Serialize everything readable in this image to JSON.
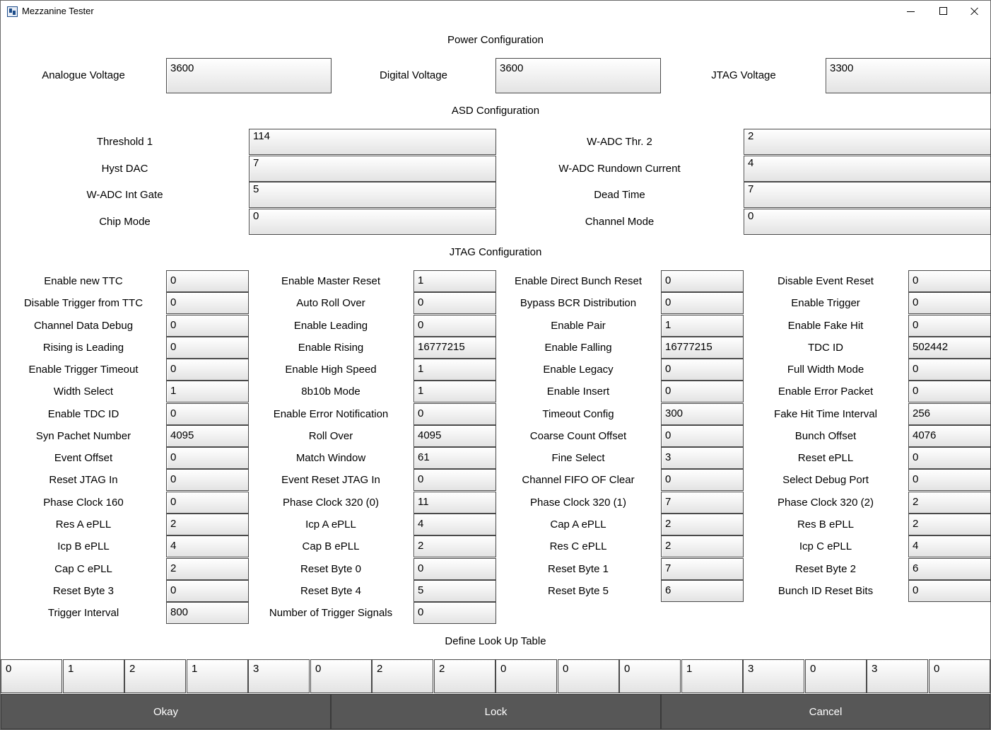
{
  "window": {
    "title": "Mezzanine Tester"
  },
  "power": {
    "title": "Power Configuration",
    "fields": [
      {
        "label": "Analogue Voltage",
        "value": "3600"
      },
      {
        "label": "Digital Voltage",
        "value": "3600"
      },
      {
        "label": "JTAG Voltage",
        "value": "3300"
      }
    ]
  },
  "asd": {
    "title": "ASD Configuration",
    "left": [
      {
        "label": "Threshold 1",
        "value": "114"
      },
      {
        "label": "Hyst DAC",
        "value": "7"
      },
      {
        "label": "W-ADC Int Gate",
        "value": "5"
      },
      {
        "label": "Chip Mode",
        "value": "0"
      }
    ],
    "right": [
      {
        "label": "W-ADC Thr. 2",
        "value": "2"
      },
      {
        "label": "W-ADC Rundown Current",
        "value": "4"
      },
      {
        "label": "Dead Time",
        "value": "7"
      },
      {
        "label": "Channel Mode",
        "value": "0"
      }
    ]
  },
  "jtag": {
    "title": "JTAG Configuration",
    "columns": [
      [
        {
          "label": "Enable new TTC",
          "value": "0"
        },
        {
          "label": "Disable Trigger from TTC",
          "value": "0"
        },
        {
          "label": "Channel Data Debug",
          "value": "0"
        },
        {
          "label": "Rising is Leading",
          "value": "0"
        },
        {
          "label": "Enable Trigger Timeout",
          "value": "0"
        },
        {
          "label": "Width Select",
          "value": "1"
        },
        {
          "label": "Enable TDC ID",
          "value": "0"
        },
        {
          "label": "Syn Pachet Number",
          "value": "4095"
        },
        {
          "label": "Event Offset",
          "value": "0"
        },
        {
          "label": "Reset JTAG In",
          "value": "0"
        },
        {
          "label": "Phase Clock 160",
          "value": "0"
        },
        {
          "label": "Res A ePLL",
          "value": "2"
        },
        {
          "label": "Icp B ePLL",
          "value": "4"
        },
        {
          "label": "Cap C ePLL",
          "value": "2"
        },
        {
          "label": "Reset Byte 3",
          "value": "0"
        },
        {
          "label": "Trigger Interval",
          "value": "800"
        }
      ],
      [
        {
          "label": "Enable Master Reset",
          "value": "1"
        },
        {
          "label": "Auto Roll Over",
          "value": "0"
        },
        {
          "label": "Enable Leading",
          "value": "0"
        },
        {
          "label": "Enable Rising",
          "value": "16777215"
        },
        {
          "label": "Enable High Speed",
          "value": "1"
        },
        {
          "label": "8b10b Mode",
          "value": "1"
        },
        {
          "label": "Enable Error Notification",
          "value": "0"
        },
        {
          "label": "Roll Over",
          "value": "4095"
        },
        {
          "label": "Match Window",
          "value": "61"
        },
        {
          "label": "Event Reset JTAG In",
          "value": "0"
        },
        {
          "label": "Phase Clock 320 (0)",
          "value": "11"
        },
        {
          "label": "Icp A ePLL",
          "value": "4"
        },
        {
          "label": "Cap B ePLL",
          "value": "2"
        },
        {
          "label": "Reset Byte 0",
          "value": "0"
        },
        {
          "label": "Reset Byte 4",
          "value": "5"
        },
        {
          "label": "Number of Trigger Signals",
          "value": "0"
        }
      ],
      [
        {
          "label": "Enable Direct Bunch Reset",
          "value": "0"
        },
        {
          "label": "Bypass BCR Distribution",
          "value": "0"
        },
        {
          "label": "Enable Pair",
          "value": "1"
        },
        {
          "label": "Enable Falling",
          "value": "16777215"
        },
        {
          "label": "Enable Legacy",
          "value": "0"
        },
        {
          "label": "Enable Insert",
          "value": "0"
        },
        {
          "label": "Timeout Config",
          "value": "300"
        },
        {
          "label": "Coarse Count Offset",
          "value": "0"
        },
        {
          "label": "Fine Select",
          "value": "3"
        },
        {
          "label": "Channel FIFO OF Clear",
          "value": "0"
        },
        {
          "label": "Phase Clock 320 (1)",
          "value": "7"
        },
        {
          "label": "Cap A ePLL",
          "value": "2"
        },
        {
          "label": "Res C ePLL",
          "value": "2"
        },
        {
          "label": "Reset Byte 1",
          "value": "7"
        },
        {
          "label": "Reset Byte 5",
          "value": "6"
        }
      ],
      [
        {
          "label": "Disable Event Reset",
          "value": "0"
        },
        {
          "label": "Enable Trigger",
          "value": "0"
        },
        {
          "label": "Enable Fake Hit",
          "value": "0"
        },
        {
          "label": "TDC ID",
          "value": "502442"
        },
        {
          "label": "Full Width Mode",
          "value": "0"
        },
        {
          "label": "Enable Error Packet",
          "value": "0"
        },
        {
          "label": "Fake Hit Time Interval",
          "value": "256"
        },
        {
          "label": "Bunch Offset",
          "value": "4076"
        },
        {
          "label": "Reset ePLL",
          "value": "0"
        },
        {
          "label": "Select Debug Port",
          "value": "0"
        },
        {
          "label": "Phase Clock 320 (2)",
          "value": "2"
        },
        {
          "label": "Res B ePLL",
          "value": "2"
        },
        {
          "label": "Icp C ePLL",
          "value": "4"
        },
        {
          "label": "Reset Byte 2",
          "value": "6"
        },
        {
          "label": "Bunch ID Reset Bits",
          "value": "0"
        }
      ]
    ]
  },
  "lut": {
    "title": "Define Look Up Table",
    "values": [
      "0",
      "1",
      "2",
      "1",
      "3",
      "0",
      "2",
      "2",
      "0",
      "0",
      "0",
      "1",
      "3",
      "0",
      "3",
      "0"
    ]
  },
  "buttons": {
    "okay": "Okay",
    "lock": "Lock",
    "cancel": "Cancel"
  }
}
